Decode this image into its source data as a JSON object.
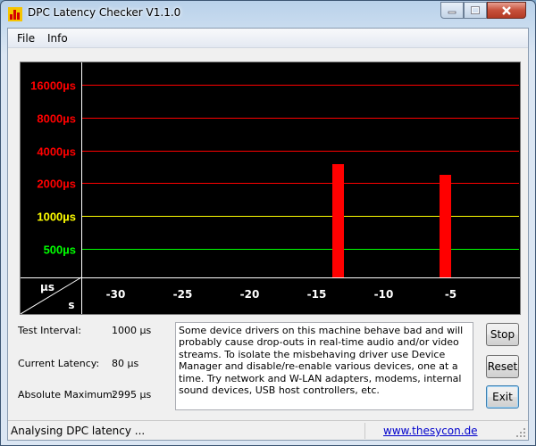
{
  "window": {
    "title": "DPC Latency Checker V1.1.0"
  },
  "menu": {
    "items": [
      "File",
      "Info"
    ]
  },
  "chart_data": {
    "type": "bar",
    "y_tick_labels": [
      {
        "label": "16000µs",
        "value": 16000,
        "color": "#ff0000"
      },
      {
        "label": "8000µs",
        "value": 8000,
        "color": "#ff0000"
      },
      {
        "label": "4000µs",
        "value": 4000,
        "color": "#ff0000"
      },
      {
        "label": "2000µs",
        "value": 2000,
        "color": "#ff0000"
      },
      {
        "label": "1000µs",
        "value": 1000,
        "color": "#ffff00"
      },
      {
        "label": "500µs",
        "value": 500,
        "color": "#00ff00"
      }
    ],
    "y_unit_label": "µs",
    "x_unit_label": "s",
    "x_tick_labels": [
      "-30",
      "-25",
      "-20",
      "-15",
      "-10",
      "-5"
    ],
    "x_tick_values": [
      -30,
      -25,
      -20,
      -15,
      -10,
      -5
    ],
    "x_range": [
      -33.5,
      0
    ],
    "y_scale": "log2",
    "bars": [
      {
        "t": -33,
        "value": 150
      },
      {
        "t": -32,
        "value": 150
      },
      {
        "t": -31,
        "value": 150
      },
      {
        "t": -30,
        "value": 150
      },
      {
        "t": -29,
        "value": 240
      },
      {
        "t": -28,
        "value": 240
      },
      {
        "t": -27,
        "value": 180
      },
      {
        "t": -26,
        "value": 180
      },
      {
        "t": -25,
        "value": 150
      },
      {
        "t": -24,
        "value": 140
      },
      {
        "t": -23,
        "value": 150
      },
      {
        "t": -22,
        "value": 170
      },
      {
        "t": -21,
        "value": 150
      },
      {
        "t": -20,
        "value": 220
      },
      {
        "t": -19,
        "value": 220
      },
      {
        "t": -18,
        "value": 240
      },
      {
        "t": -17,
        "value": 170
      },
      {
        "t": -16,
        "value": 170
      },
      {
        "t": -15,
        "value": 160
      },
      {
        "t": -14,
        "value": 160
      },
      {
        "t": -13,
        "value": 2995
      },
      {
        "t": -12,
        "value": 170
      },
      {
        "t": -11,
        "value": 160
      },
      {
        "t": -10,
        "value": 160
      },
      {
        "t": -9,
        "value": 170
      },
      {
        "t": -8,
        "value": 200
      },
      {
        "t": -7,
        "value": 160
      },
      {
        "t": -6,
        "value": 160
      },
      {
        "t": -5,
        "value": 2400
      },
      {
        "t": -4,
        "value": 140
      },
      {
        "t": -3,
        "value": 160
      },
      {
        "t": -2,
        "value": 150
      },
      {
        "t": -1,
        "value": 150
      },
      {
        "t": 0,
        "value": 160
      }
    ],
    "colors": {
      "normal": "#00ff00",
      "warning": "#ffff00",
      "critical": "#ff0000",
      "background": "#000000"
    }
  },
  "stats": {
    "test_interval_label": "Test Interval:",
    "test_interval_value": "1000 µs",
    "current_latency_label": "Current Latency:",
    "current_latency_value": "80 µs",
    "absolute_maximum_label": "Absolute Maximum:",
    "absolute_maximum_value": "2995 µs"
  },
  "description": "Some device drivers on this machine behave bad and will probably cause drop-outs in real-time audio and/or video streams. To isolate the misbehaving driver use Device Manager and disable/re-enable various devices, one at a time. Try network and W-LAN adapters, modems, internal sound devices, USB host controllers, etc.",
  "buttons": {
    "stop": "Stop",
    "reset": "Reset",
    "exit": "Exit"
  },
  "status": {
    "text": "Analysing DPC latency ...",
    "link": "www.thesycon.de"
  }
}
